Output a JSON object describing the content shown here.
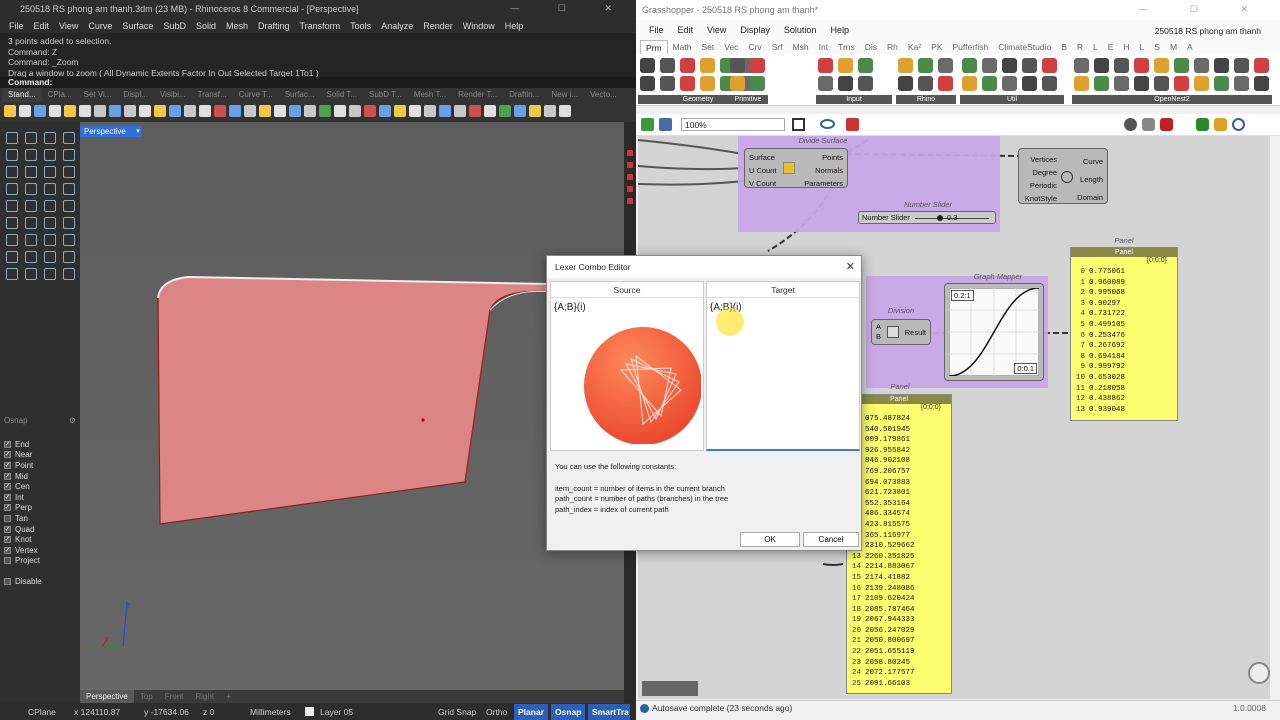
{
  "rhino": {
    "title": "250518 RS phong am thanh.3dm (23 MB) - Rhinoceros 8 Commercial - [Perspective]",
    "window_controls": "— ☐ ✕",
    "menu": [
      "File",
      "Edit",
      "View",
      "Curve",
      "Surface",
      "SubD",
      "Solid",
      "Mesh",
      "Drafting",
      "Transform",
      "Tools",
      "Analyze",
      "Render",
      "Window",
      "Help"
    ],
    "command_history": [
      "3 points added to selection.",
      "Command: Z",
      "Command: _Zoom",
      "Drag a window to zoom ( All  Dynamic  Extents  Factor  In  Out  Selected  Target  1To1 )"
    ],
    "command_prompt": "Command:",
    "toolbar_tabs": [
      "Stand...",
      "CPla...",
      "Set Vi...",
      "Displ...",
      "Visibi...",
      "Transf...",
      "Curve T...",
      "Surfac...",
      "Solid T...",
      "SubD T...",
      "Mesh T...",
      "Render T...",
      "Draftin...",
      "New i...",
      "Vecto..."
    ],
    "viewport_name": "Perspective",
    "viewport_dropdown": "▾",
    "viewport_tabs": [
      "Perspective",
      "Top",
      "Front",
      "Right",
      "+"
    ],
    "osnap": {
      "header": "Osnap",
      "items": [
        {
          "label": "End",
          "checked": true
        },
        {
          "label": "Near",
          "checked": true
        },
        {
          "label": "Point",
          "checked": true
        },
        {
          "label": "Mid",
          "checked": true
        },
        {
          "label": "Cen",
          "checked": true
        },
        {
          "label": "Int",
          "checked": true
        },
        {
          "label": "Perp",
          "checked": true
        },
        {
          "label": "Tan",
          "checked": false
        },
        {
          "label": "Quad",
          "checked": true
        },
        {
          "label": "Knot",
          "checked": true
        },
        {
          "label": "Vertex",
          "checked": true
        },
        {
          "label": "Project",
          "checked": false
        }
      ],
      "disable": "Disable"
    },
    "status": {
      "cplane": "CPlane",
      "x": "x 124110.87",
      "y": "y -17634.06",
      "z": "z 0",
      "units": "Millimeters",
      "layer": "Layer 05",
      "grid_snap": "Grid Snap",
      "ortho": "Ortho",
      "planar": "Planar",
      "osnap": "Osnap",
      "smarttrack": "SmartTra"
    },
    "axis_labels": {
      "x": "x",
      "y": "y",
      "z": "z"
    }
  },
  "grasshopper": {
    "title": "Grasshopper - 250518 RS phong am thanh*",
    "window_controls": "— ☐ ✕",
    "menu": [
      "File",
      "Edit",
      "View",
      "Display",
      "Solution",
      "Help"
    ],
    "document_name": "250518 RS phong am thanh",
    "tabs": [
      "Prm",
      "Math",
      "Set",
      "Vec",
      "Crv",
      "Srf",
      "Msh",
      "Int",
      "Trns",
      "Dis",
      "Rh",
      "Ka²",
      "PK",
      "Pufferfish",
      "ClimateStudio",
      "B",
      "R",
      "L",
      "E",
      "H",
      "L",
      "S",
      "M",
      "A"
    ],
    "ribbon_groups": [
      "Geometry",
      "Primitive",
      "Input",
      "Rhino",
      "Util",
      "OpenNest2"
    ],
    "zoom": "100%",
    "status": "Autosave complete (23 seconds ago)",
    "version": "1.0.0008",
    "divide_surface": {
      "title": "Divide Surface",
      "inputs": [
        "Surface",
        "U Count",
        "V Count"
      ],
      "outputs": [
        "Points",
        "Normals",
        "Parameters"
      ]
    },
    "interpolate": {
      "inputs": [
        "Vertices",
        "Degree",
        "Periodic",
        "KnotStyle"
      ],
      "outputs": [
        "Curve",
        "Length",
        "Domain"
      ]
    },
    "number_slider": {
      "title": "Number Slider",
      "label": "Number Slider",
      "value": "0.3"
    },
    "division": {
      "title": "Division",
      "inputs": [
        "A",
        "B"
      ],
      "output": "Result"
    },
    "graph_mapper": {
      "title": "Graph Mapper",
      "top_label": "0.2:1",
      "bottom_label": "0:0.1"
    },
    "panel1": {
      "title": "Panel",
      "header": "Panel",
      "path": "{0;0;0}",
      "rows": [
        {
          "i": "0",
          "v": "0.775061"
        },
        {
          "i": "1",
          "v": "0.960089"
        },
        {
          "i": "2",
          "v": "0.995068"
        },
        {
          "i": "3",
          "v": "0.90297"
        },
        {
          "i": "4",
          "v": "0.731722"
        },
        {
          "i": "5",
          "v": "0.499105"
        },
        {
          "i": "6",
          "v": "0.253476"
        },
        {
          "i": "7",
          "v": "0.267692"
        },
        {
          "i": "8",
          "v": "0.694184"
        },
        {
          "i": "9",
          "v": "0.999792"
        },
        {
          "i": "10",
          "v": "0.653028"
        },
        {
          "i": "11",
          "v": "0.218058"
        },
        {
          "i": "12",
          "v": "0.438862"
        },
        {
          "i": "13",
          "v": "0.939048"
        }
      ]
    },
    "panel2": {
      "title": "Panel",
      "header": "Panel",
      "path": "{0;0;0}",
      "rows": [
        {
          "i": "",
          "v": "075.487824"
        },
        {
          "i": "",
          "v": "540.501945"
        },
        {
          "i": "",
          "v": "009.179861"
        },
        {
          "i": "",
          "v": "926.955842"
        },
        {
          "i": "",
          "v": "846.902108"
        },
        {
          "i": "",
          "v": "769.206757"
        },
        {
          "i": "",
          "v": "694.073883"
        },
        {
          "i": "",
          "v": "621.723801"
        },
        {
          "i": "",
          "v": "552.353164"
        },
        {
          "i": "",
          "v": "486.334574"
        },
        {
          "i": "",
          "v": "423.815575"
        },
        {
          "i": "",
          "v": "365.116977"
        },
        {
          "i": "",
          "v": "2310.529662"
        },
        {
          "i": "13",
          "v": "2260.351825"
        },
        {
          "i": "14",
          "v": "2214.883067"
        },
        {
          "i": "15",
          "v": "2174.41882"
        },
        {
          "i": "16",
          "v": "2139.248086"
        },
        {
          "i": "17",
          "v": "2109.620424"
        },
        {
          "i": "18",
          "v": "2085.787464"
        },
        {
          "i": "19",
          "v": "2067.944333"
        },
        {
          "i": "20",
          "v": "2056.247029"
        },
        {
          "i": "21",
          "v": "2050.800697"
        },
        {
          "i": "22",
          "v": "2051.655119"
        },
        {
          "i": "23",
          "v": "2058.80245"
        },
        {
          "i": "24",
          "v": "2072.177577"
        },
        {
          "i": "25",
          "v": "2091.66103"
        }
      ]
    }
  },
  "dialog": {
    "title": "Lexer Combo Editor",
    "close": "✕",
    "source_header": "Source",
    "target_header": "Target",
    "source_value": "{A;B}(i)",
    "target_value": "{A;B}(i)",
    "info_intro": "You can use the following constants:",
    "info_lines": [
      "item_count = number of items in the current branch",
      "path_count = number of paths (branches) in the tree",
      "path_index = index of current path"
    ],
    "ok": "OK",
    "cancel": "Cancel"
  }
}
